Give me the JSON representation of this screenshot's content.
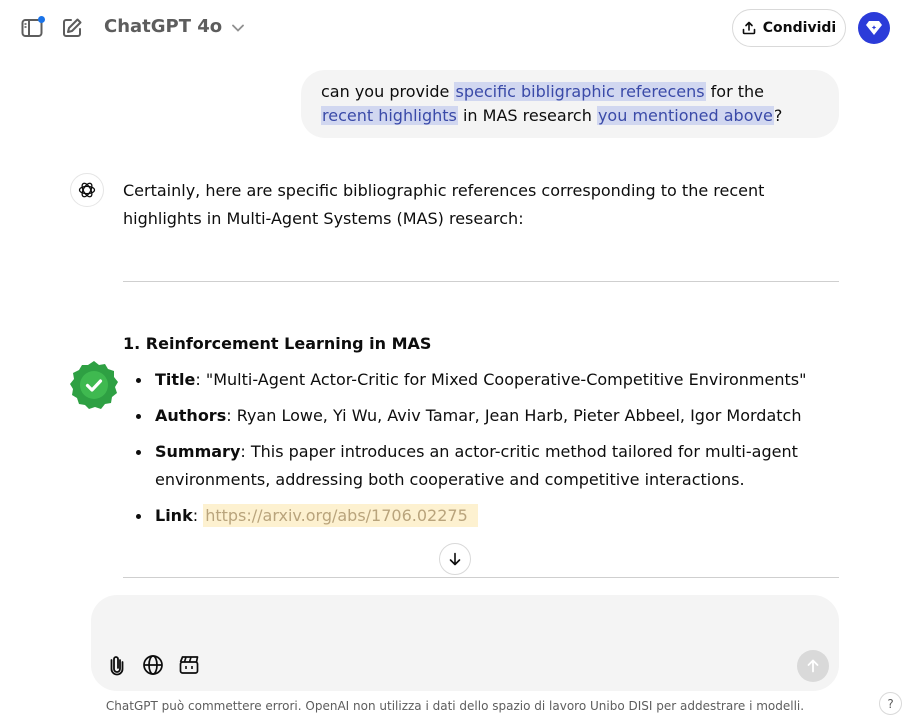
{
  "header": {
    "model_name": "ChatGPT 4o",
    "share_label": "Condividi"
  },
  "user_message": {
    "parts": [
      "can you provide ",
      "specific bibligraphic referecens",
      " for the ",
      "recent highlights",
      " in MAS research ",
      "you mentioned above",
      "?"
    ]
  },
  "assistant": {
    "intro": "Certainly, here are specific bibliographic references corresponding to the recent highlights in Multi-Agent Systems (MAS) research:",
    "section_title": "1. Reinforcement Learning in MAS",
    "items": [
      {
        "label": "Title",
        "sep": ": ",
        "text": "\"Multi-Agent Actor-Critic for Mixed Cooperative-Competitive Environments\""
      },
      {
        "label": "Authors",
        "sep": ": ",
        "text": "Ryan Lowe, Yi Wu, Aviv Tamar, Jean Harb, Pieter Abbeel, Igor Mordatch"
      },
      {
        "label": "Summary",
        "sep": ": ",
        "text": "This paper introduces an actor-critic method tailored for multi-agent environments, addressing both cooperative and competitive interactions."
      },
      {
        "label": "Link",
        "sep": ": ",
        "text": "https://arxiv.org/abs/1706.02275"
      }
    ]
  },
  "composer": {
    "placeholder": ""
  },
  "footer": {
    "disclaimer": "ChatGPT può commettere errori. OpenAI non utilizza i dati dello spazio di lavoro Unibo DISI per addestrare i modelli.",
    "help_label": "?"
  },
  "colors": {
    "accent": "#2b3bd9",
    "badge_green": "#2ea043",
    "highlight": "#c9d0f5",
    "link_highlight": "#fdf1d0"
  }
}
